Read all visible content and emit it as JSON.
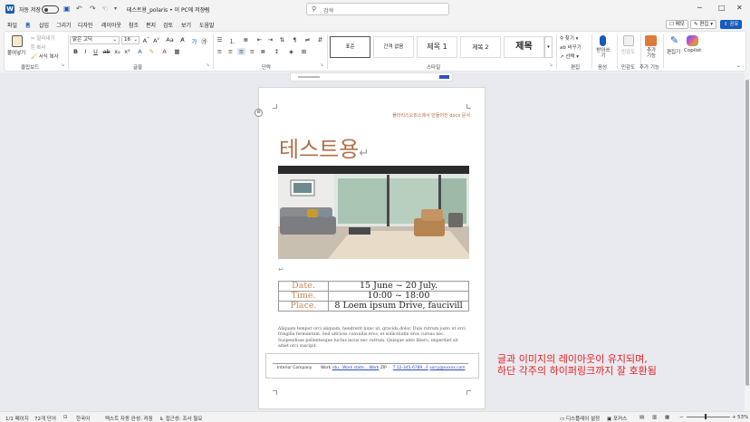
{
  "titlebar": {
    "autosave_label": "자동 저장",
    "document_title": "테스트용_polaris • 이 PC에 저장됨",
    "search_placeholder": "검색",
    "minimize": "─",
    "maximize": "□",
    "close": "✕"
  },
  "menu": {
    "items": [
      "파일",
      "홈",
      "삽입",
      "그리기",
      "디자인",
      "레이아웃",
      "참조",
      "편지",
      "검토",
      "보기",
      "도움말"
    ],
    "active": "홈",
    "memo_label": "메모",
    "edit_label": "편집",
    "share_label": "공유"
  },
  "ribbon": {
    "clipboard": {
      "paste": "붙여넣기",
      "cut": "잘라내기",
      "copy": "복사",
      "format_painter": "서식 복사",
      "group": "클립보드"
    },
    "font": {
      "font_name": "맑은 고딕",
      "font_size": "16",
      "group": "글꼴"
    },
    "paragraph": {
      "group": "단락"
    },
    "styles": {
      "items": [
        "표준",
        "간격 없음",
        "제목 1",
        "제목 2",
        "제목"
      ],
      "group": "스타일"
    },
    "editing": {
      "find": "찾기",
      "replace": "바꾸기",
      "select": "선택",
      "group": "편집"
    },
    "voice": {
      "dictate": "받아쓰기",
      "group": "음성"
    },
    "sensitivity": {
      "label": "민감도",
      "group": "민감도"
    },
    "addins": {
      "label": "추가 기능",
      "group": "추가 기능"
    },
    "editor": {
      "label": "편집기"
    },
    "copilot": {
      "label": "Copilot"
    }
  },
  "document": {
    "header_text": "폴라리스오피스에서 만들어진 docx 문서",
    "title": "테스트용",
    "event_rows": [
      {
        "key": "Date.",
        "value": "15 June ~ 20 July."
      },
      {
        "key": "Time.",
        "value": "10:00 ~ 18:00"
      },
      {
        "key": "Place.",
        "value": "8 Loem ipsum Drive, faucivill"
      }
    ],
    "lorem": "Aliquam tempor orci aliquam, hendrerit nunc ut, gravida dolor. Duis rutrum justo ut orci fringilla fermentum. Sed ultrices convallis eros, et sollicitudin eros cursus nec. Suspendisse pellentesque luctus lacus nec rutrum. Quisque ante libero, imperdiet sit amet orci suscipit.",
    "footer": {
      "company": "Interior Company",
      "work_prefix": "Work",
      "work_link": "rdu...Work state....Work",
      "zip": "ZIP",
      "tel": "T 12-345-6789...F",
      "email": "sorry@xxxxx.com"
    }
  },
  "overlay": {
    "line1": "글과 이미지의 레이아웃이 유지되며,",
    "line2": "하단 각주의 하이퍼링크까지 잘 호환됨"
  },
  "statusbar": {
    "page": "1/1 페이지",
    "words": "72개 단어",
    "language": "한국어",
    "text_predictions": "텍스트 자동 완성: 켜짐",
    "accessibility": "접근성: 조사 필요",
    "display_settings": "디스플레이 설정",
    "focus": "포커스",
    "zoom": "53%"
  },
  "colors": {
    "accent": "#185abd",
    "title_brown": "#b07048",
    "overlay_red": "#e8201e"
  }
}
